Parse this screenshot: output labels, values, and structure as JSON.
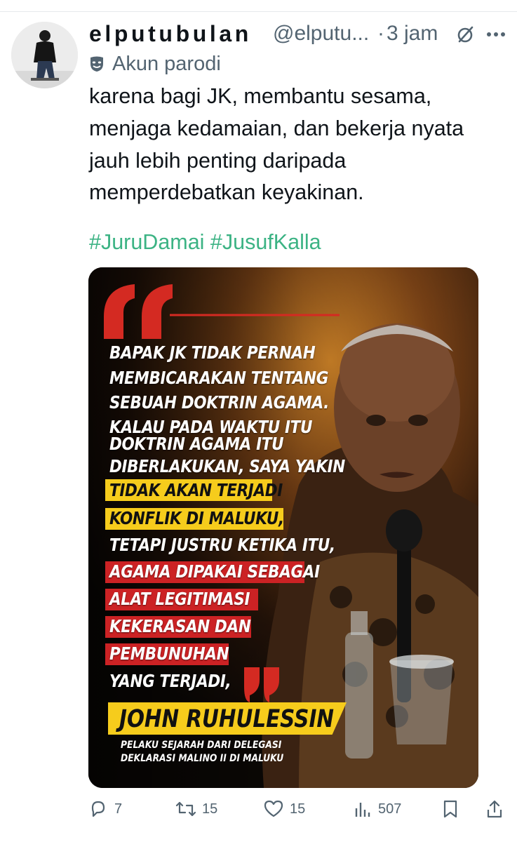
{
  "tweet": {
    "display_name": "elputubulan",
    "handle": "@elputu...",
    "separator": "·",
    "time": "3 jam",
    "label": "Akun parodi",
    "text_lines": [
      "karena bagi JK, membantu sesama,",
      "menjaga kedamaian, dan bekerja nyata",
      "jauh lebih penting daripada",
      "memperdebatkan keyakinan."
    ],
    "hashtags": [
      "#JuruDamai",
      "#JusufKalla"
    ]
  },
  "media": {
    "quote_lines": [
      "BAPAK JK TIDAK PERNAH",
      "MEMBICARAKAN TENTANG",
      "SEBUAH DOKTRIN AGAMA.",
      "KALAU PADA WAKTU ITU",
      "DOKTRIN AGAMA ITU",
      "DIBERLAKUKAN, SAYA YAKIN",
      "TIDAK AKAN TERJADI",
      "KONFLIK DI MALUKU,",
      "TETAPI JUSTRU KETIKA ITU,",
      "AGAMA DIPAKAI SEBAGAI",
      "ALAT LEGITIMASI",
      "KEKERASAN DAN",
      "PEMBUNUHAN",
      "YANG TERJADI,"
    ],
    "author": "JOHN RUHULESSIN",
    "subtitle_lines": [
      "PELAKU SEJARAH DARI DELEGASI",
      "DEKLARASI MALINO II DI MALUKU"
    ],
    "colors": {
      "highlight_yellow": "#f6cc1c",
      "highlight_red": "#cc2224",
      "quote_mark": "#d42a22"
    }
  },
  "actions": {
    "replies": "7",
    "reposts": "15",
    "likes": "15",
    "views": "507"
  },
  "icons": {
    "grok": "grok-icon",
    "more": "more-icon",
    "parody": "parody-mask-icon",
    "reply": "reply-icon",
    "repost": "repost-icon",
    "like": "heart-icon",
    "views": "views-icon",
    "bookmark": "bookmark-icon",
    "share": "share-icon"
  }
}
